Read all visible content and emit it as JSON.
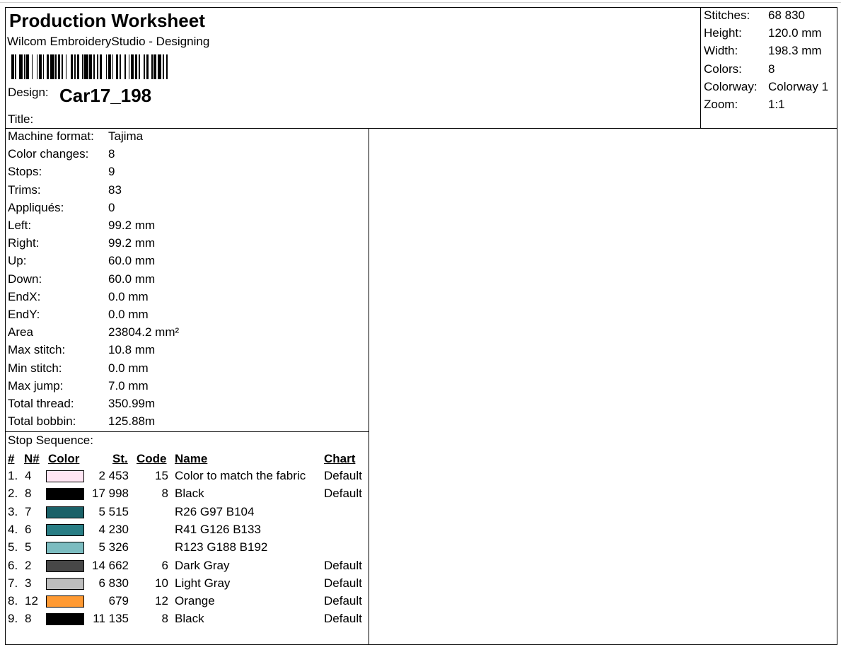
{
  "header": {
    "title": "Production Worksheet",
    "subtitle": "Wilcom EmbroideryStudio - Designing",
    "design_label": "Design:",
    "design_value": "Car17_198",
    "title_label": "Title:"
  },
  "summary": [
    {
      "label": "Stitches:",
      "value": "68 830"
    },
    {
      "label": "Height:",
      "value": "120.0 mm"
    },
    {
      "label": "Width:",
      "value": "198.3 mm"
    },
    {
      "label": "Colors:",
      "value": "8"
    },
    {
      "label": "Colorway:",
      "value": "Colorway 1"
    },
    {
      "label": "Zoom:",
      "value": "1:1"
    }
  ],
  "details": [
    {
      "label": "Machine format:",
      "value": "Tajima"
    },
    {
      "label": "Color changes:",
      "value": "8"
    },
    {
      "label": "Stops:",
      "value": "9"
    },
    {
      "label": "Trims:",
      "value": "83"
    },
    {
      "label": "Appliqués:",
      "value": "0"
    },
    {
      "label": "Left:",
      "value": "99.2 mm"
    },
    {
      "label": "Right:",
      "value": "99.2 mm"
    },
    {
      "label": "Up:",
      "value": "60.0 mm"
    },
    {
      "label": "Down:",
      "value": "60.0 mm"
    },
    {
      "label": "EndX:",
      "value": "0.0 mm"
    },
    {
      "label": "EndY:",
      "value": "0.0 mm"
    },
    {
      "label": "Area",
      "value": "23804.2 mm²"
    },
    {
      "label": "Max stitch:",
      "value": "10.8 mm"
    },
    {
      "label": "Min stitch:",
      "value": "0.0 mm"
    },
    {
      "label": "Max jump:",
      "value": "7.0 mm"
    },
    {
      "label": "Total thread:",
      "value": "350.99m"
    },
    {
      "label": "Total bobbin:",
      "value": "125.88m"
    }
  ],
  "stop_sequence": {
    "title": "Stop Sequence:",
    "headers": {
      "num": "#",
      "needle": "N#",
      "color": "Color",
      "stitches": "St.",
      "code": "Code",
      "name": "Name",
      "chart": "Chart"
    },
    "rows": [
      {
        "num": "1.",
        "needle": "4",
        "color": "#ffe6f4",
        "stitches": "2 453",
        "code": "15",
        "name": "Color to match the fabric",
        "chart": "Default"
      },
      {
        "num": "2.",
        "needle": "8",
        "color": "#000000",
        "stitches": "17 998",
        "code": "8",
        "name": "Black",
        "chart": "Default"
      },
      {
        "num": "3.",
        "needle": "7",
        "color": "#1a6168",
        "stitches": "5 515",
        "code": "",
        "name": "R26 G97 B104",
        "chart": ""
      },
      {
        "num": "4.",
        "needle": "6",
        "color": "#297e85",
        "stitches": "4 230",
        "code": "",
        "name": "R41 G126 B133",
        "chart": ""
      },
      {
        "num": "5.",
        "needle": "5",
        "color": "#7bbcc0",
        "stitches": "5 326",
        "code": "",
        "name": "R123 G188 B192",
        "chart": ""
      },
      {
        "num": "6.",
        "needle": "2",
        "color": "#474747",
        "stitches": "14 662",
        "code": "6",
        "name": "Dark Gray",
        "chart": "Default"
      },
      {
        "num": "7.",
        "needle": "3",
        "color": "#bebebe",
        "stitches": "6 830",
        "code": "10",
        "name": "Light Gray",
        "chart": "Default"
      },
      {
        "num": "8.",
        "needle": "12",
        "color": "#ff9a33",
        "stitches": "679",
        "code": "12",
        "name": "Orange",
        "chart": "Default"
      },
      {
        "num": "9.",
        "needle": "8",
        "color": "#000000",
        "stitches": "11 135",
        "code": "8",
        "name": "Black",
        "chart": "Default"
      }
    ]
  }
}
